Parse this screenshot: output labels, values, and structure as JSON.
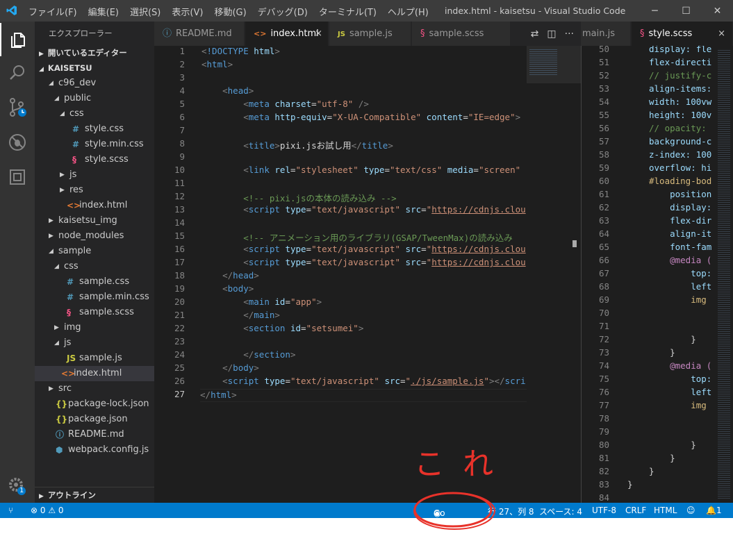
{
  "window": {
    "title": "index.html - kaisetsu - Visual Studio Code",
    "menu": [
      "ファイル(F)",
      "編集(E)",
      "選択(S)",
      "表示(V)",
      "移動(G)",
      "デバッグ(D)",
      "ターミナル(T)",
      "ヘルプ(H)"
    ]
  },
  "sidebar": {
    "title": "エクスプローラー",
    "open_editors": "開いているエディター",
    "root": "KAISETSU",
    "outline": "アウトライン",
    "tree": [
      {
        "label": "c96_dev",
        "twisty": "◢",
        "icon": "",
        "color": "#ccc"
      },
      {
        "label": "public",
        "twisty": "◢",
        "icon": "",
        "color": "#ccc"
      },
      {
        "label": "css",
        "twisty": "◢",
        "icon": "",
        "color": "#ccc"
      },
      {
        "label": "style.css",
        "twisty": "",
        "icon": "#",
        "color": "#519aba"
      },
      {
        "label": "style.min.css",
        "twisty": "",
        "icon": "#",
        "color": "#519aba"
      },
      {
        "label": "style.scss",
        "twisty": "",
        "icon": "§",
        "color": "#f55385"
      },
      {
        "label": "js",
        "twisty": "▶",
        "icon": "",
        "color": "#ccc"
      },
      {
        "label": "res",
        "twisty": "▶",
        "icon": "",
        "color": "#ccc"
      },
      {
        "label": "index.html",
        "twisty": "",
        "icon": "<>",
        "color": "#e37933"
      },
      {
        "label": "kaisetsu_img",
        "twisty": "▶",
        "icon": "",
        "color": "#ccc"
      },
      {
        "label": "node_modules",
        "twisty": "▶",
        "icon": "",
        "color": "#ccc"
      },
      {
        "label": "sample",
        "twisty": "◢",
        "icon": "",
        "color": "#ccc"
      },
      {
        "label": "css",
        "twisty": "◢",
        "icon": "",
        "color": "#ccc"
      },
      {
        "label": "sample.css",
        "twisty": "",
        "icon": "#",
        "color": "#519aba"
      },
      {
        "label": "sample.min.css",
        "twisty": "",
        "icon": "#",
        "color": "#519aba"
      },
      {
        "label": "sample.scss",
        "twisty": "",
        "icon": "§",
        "color": "#f55385"
      },
      {
        "label": "img",
        "twisty": "▶",
        "icon": "",
        "color": "#ccc"
      },
      {
        "label": "js",
        "twisty": "◢",
        "icon": "",
        "color": "#ccc"
      },
      {
        "label": "sample.js",
        "twisty": "",
        "icon": "JS",
        "color": "#cbcb41"
      },
      {
        "label": "index.html",
        "twisty": "",
        "icon": "<>",
        "color": "#e37933"
      },
      {
        "label": "src",
        "twisty": "▶",
        "icon": "",
        "color": "#ccc"
      },
      {
        "label": "package-lock.json",
        "twisty": "",
        "icon": "{}",
        "color": "#cbcb41"
      },
      {
        "label": "package.json",
        "twisty": "",
        "icon": "{}",
        "color": "#cbcb41"
      },
      {
        "label": "README.md",
        "twisty": "",
        "icon": "ⓘ",
        "color": "#519aba"
      },
      {
        "label": "webpack.config.js",
        "twisty": "",
        "icon": "⬢",
        "color": "#519aba"
      }
    ]
  },
  "tabs": [
    {
      "label": "README.md",
      "icon": "ⓘ",
      "color": "#519aba"
    },
    {
      "label": "index.html",
      "icon": "<>",
      "color": "#e37933",
      "close": "×"
    },
    {
      "label": "sample.js",
      "icon": "JS",
      "color": "#cbcb41"
    },
    {
      "label": "sample.scss",
      "icon": "§",
      "color": "#f55385"
    }
  ],
  "tabs2": [
    {
      "label": "main.js",
      "icon": "",
      "color": "#ccc"
    },
    {
      "label": "style.scss",
      "icon": "§",
      "color": "#f55385",
      "close": "×"
    }
  ],
  "editor": {
    "line_numbers": [
      "1",
      "2",
      "3",
      "4",
      "5",
      "6",
      "7",
      "8",
      "9",
      "10",
      "11",
      "12",
      "13",
      "14",
      "15",
      "16",
      "17",
      "18",
      "19",
      "20",
      "21",
      "22",
      "23",
      "24",
      "25",
      "26",
      "27"
    ]
  },
  "editor2": {
    "line_numbers": [
      "50",
      "51",
      "52",
      "53",
      "54",
      "55",
      "56",
      "57",
      "58",
      "59",
      "60",
      "61",
      "62",
      "63",
      "64",
      "65",
      "66",
      "67",
      "68",
      "69",
      "70",
      "71",
      "72",
      "73",
      "74",
      "75",
      "76",
      "77",
      "78",
      "79",
      "80",
      "81",
      "82",
      "83",
      "84"
    ],
    "lines": [
      {
        "text": "display: fle",
        "color": "#9cdcfe"
      },
      {
        "text": "flex-directi",
        "color": "#9cdcfe"
      },
      {
        "text": "// justify-c",
        "color": "#6a9955"
      },
      {
        "text": "align-items:",
        "color": "#9cdcfe"
      },
      {
        "text": "width: 100vw",
        "color": "#9cdcfe"
      },
      {
        "text": "height: 100v",
        "color": "#9cdcfe"
      },
      {
        "text": "// opacity: ",
        "color": "#6a9955"
      },
      {
        "text": "background-c",
        "color": "#9cdcfe"
      },
      {
        "text": "z-index: 100",
        "color": "#9cdcfe"
      },
      {
        "text": "overflow: hi",
        "color": "#9cdcfe"
      },
      {
        "text": "#loading-bod",
        "color": "#d7ba7d"
      },
      {
        "text": "    position",
        "color": "#9cdcfe"
      },
      {
        "text": "    display:",
        "color": "#9cdcfe"
      },
      {
        "text": "    flex-dir",
        "color": "#9cdcfe"
      },
      {
        "text": "    align-it",
        "color": "#9cdcfe"
      },
      {
        "text": "    font-fam",
        "color": "#9cdcfe"
      },
      {
        "text": "    @media (",
        "color": "#c586c0"
      },
      {
        "text": "        top:",
        "color": "#9cdcfe"
      },
      {
        "text": "        left",
        "color": "#9cdcfe"
      },
      {
        "text": "        img ",
        "color": "#d7ba7d"
      },
      {
        "text": "",
        "color": "#d4d4d4"
      },
      {
        "text": "",
        "color": "#d4d4d4"
      },
      {
        "text": "        }",
        "color": "#d4d4d4"
      },
      {
        "text": "    }",
        "color": "#d4d4d4"
      },
      {
        "text": "    @media (",
        "color": "#c586c0"
      },
      {
        "text": "        top:",
        "color": "#9cdcfe"
      },
      {
        "text": "        left",
        "color": "#9cdcfe"
      },
      {
        "text": "        img ",
        "color": "#d7ba7d"
      },
      {
        "text": "",
        "color": "#d4d4d4"
      },
      {
        "text": "",
        "color": "#d4d4d4"
      },
      {
        "text": "        }",
        "color": "#d4d4d4"
      },
      {
        "text": "    }",
        "color": "#d4d4d4"
      },
      {
        "text": "}",
        "color": "#d4d4d4"
      },
      {
        "text": "}",
        "color": "#d4d4d4"
      },
      {
        "text": "",
        "color": "#d4d4d4"
      }
    ]
  },
  "status": {
    "branch_icon": "⑂",
    "errors": "0",
    "warnings": "0",
    "go_live": "Go Live",
    "position": "行 27、列 8",
    "spaces": "スペース: 4",
    "encoding": "UTF-8",
    "eol": "CRLF",
    "language": "HTML",
    "notifications": "1"
  },
  "annotation": "これ",
  "settings_badge": "1",
  "colors": {
    "accent": "#007acc",
    "annotation": "#e8322a"
  }
}
